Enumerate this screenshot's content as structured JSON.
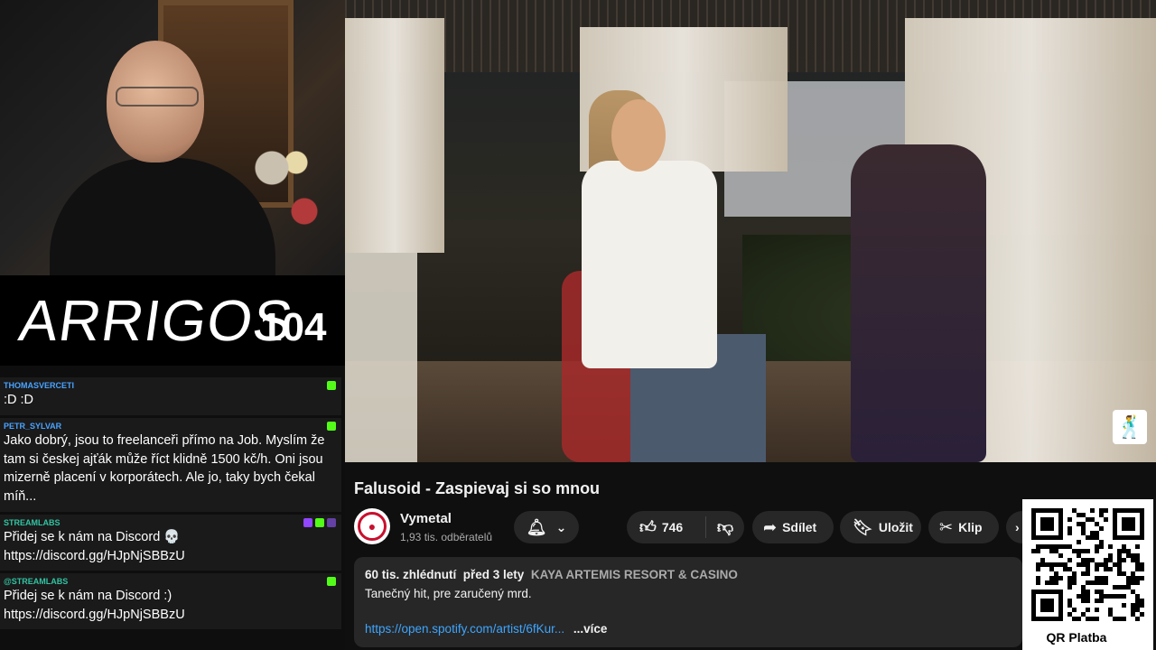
{
  "overlay": {
    "logo_text": "ARRIGOS",
    "episode": "104",
    "qr_label": "QR Platba"
  },
  "chat": {
    "messages": [
      {
        "user": "THOMASVERCETI",
        "text": ":D :D",
        "color": "#4aa3ff"
      },
      {
        "user": "PETR_SYLVAR",
        "text": "Jako dobrý, jsou to freelanceři přímo na Job. Myslím že tam si českej ajťák může říct klidně 1500 kč/h. Oni jsou mizerně placení v korporátech. Ale jo, taky bych čekal míň...",
        "color": "#4aa3ff"
      },
      {
        "user": "STREAMLABS",
        "text": "Přidej se k nám na Discord 💀 https://discord.gg/HJpNjSBBzU",
        "color": "#31c3a2"
      },
      {
        "user": "@STREAMLABS",
        "text": "Přidej se k nám na Discord :) https://discord.gg/HJpNjSBBzU",
        "color": "#31c3a2"
      }
    ]
  },
  "video": {
    "title": "Falusoid - Zaspievaj si so mnou",
    "channel_name": "Vymetal",
    "subscribers": "1,93 tis. odběratelů",
    "likes": "746",
    "share_label": "Sdílet",
    "save_label": "Uložit",
    "clip_label": "Klip",
    "views": "60 tis. zhlédnutí",
    "age": "před 3 lety",
    "location": "KAYA ARTEMIS RESORT & CASINO",
    "description": "Tanečný hit, pre zaručený mrd.",
    "link": "https://open.spotify.com/artist/6fKur...",
    "more_label": "...více"
  },
  "colors": {
    "youtube_bg": "#0f0f0f",
    "pill_bg": "#272727",
    "link": "#3ea6ff",
    "kick_green": "#53fc18"
  }
}
